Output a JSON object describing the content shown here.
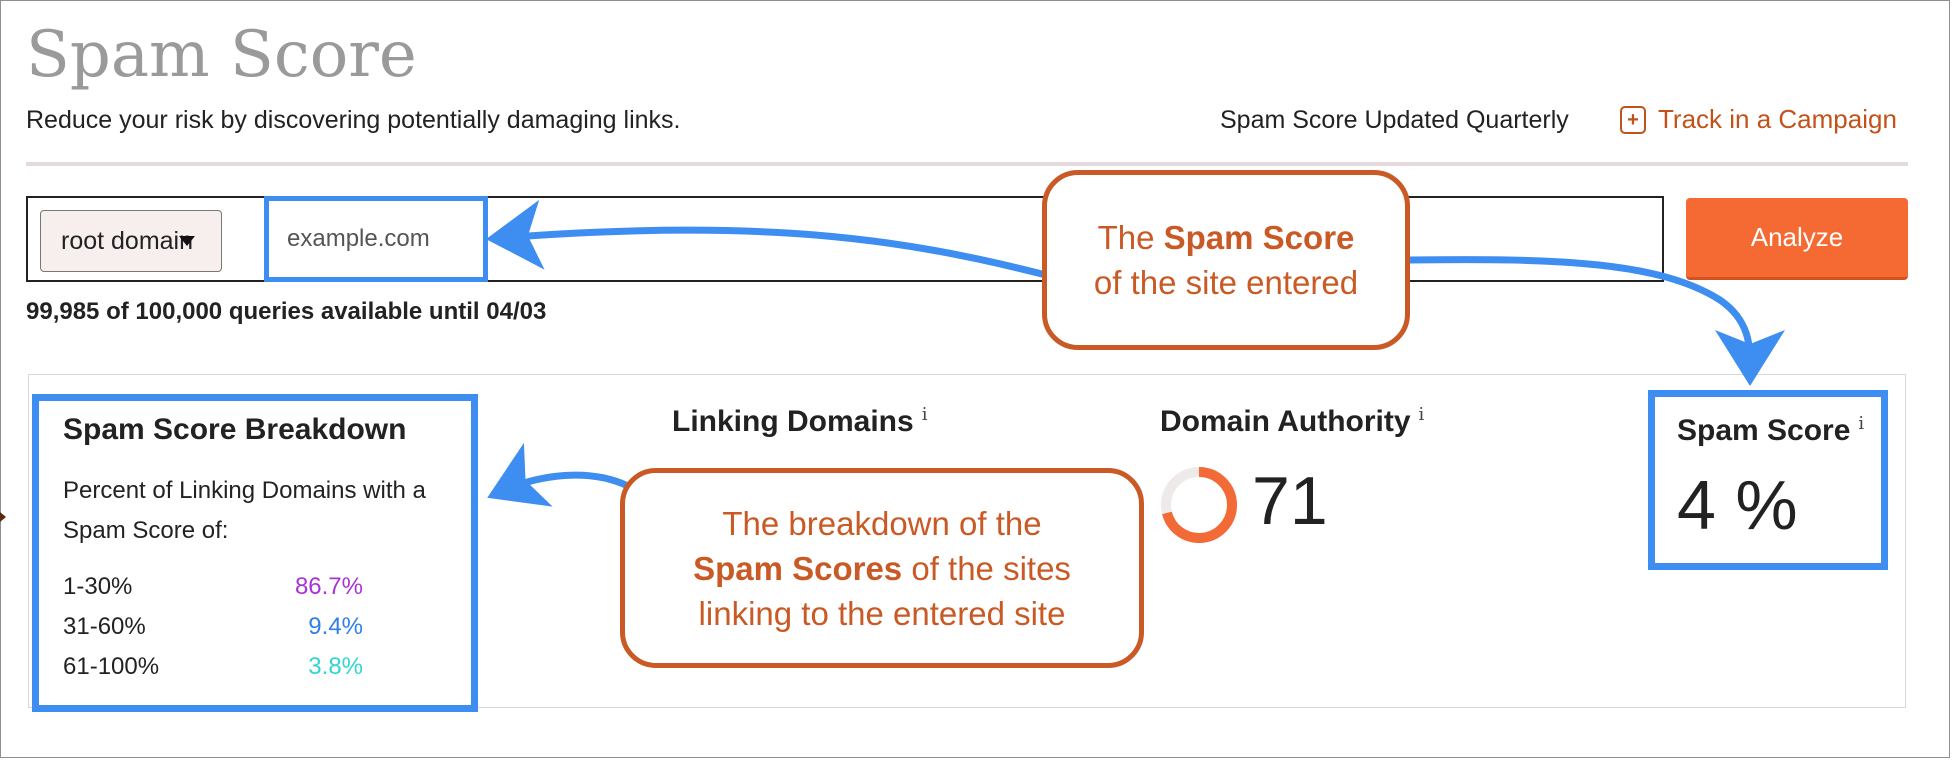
{
  "header": {
    "title": "Spam Score",
    "subtitle": "Reduce your risk by discovering potentially damaging links.",
    "update_note": "Spam Score Updated Quarterly",
    "track_link_label": "Track in a Campaign",
    "track_icon": "plus-box-icon",
    "track_icon_glyph": "+"
  },
  "search": {
    "scope_select": {
      "selected": "root domain",
      "icon": "caret-down-icon"
    },
    "domain_input": {
      "value": "",
      "placeholder": "example.com"
    },
    "analyze_label": "Analyze",
    "queries_status": "99,985 of 100,000 queries available until 04/03"
  },
  "results": {
    "breakdown": {
      "title": "Spam Score Breakdown",
      "description": "Percent of Linking Domains with a Spam Score of:",
      "rows": [
        {
          "range": "1-30%",
          "percent": "86.7%",
          "color": "#a933d6"
        },
        {
          "range": "31-60%",
          "percent": "9.4%",
          "color": "#2f7fe6"
        },
        {
          "range": "61-100%",
          "percent": "3.8%",
          "color": "#2ed6d0"
        }
      ]
    },
    "linking_domains": {
      "title": "Linking Domains",
      "info_glyph": "i"
    },
    "domain_authority": {
      "title": "Domain Authority",
      "info_glyph": "i",
      "value": "71",
      "ring_fraction": 0.71,
      "ring_color": "#f26b36",
      "ring_track_color": "#eeeaea"
    },
    "spam_score": {
      "title": "Spam Score",
      "info_glyph": "i",
      "value": "4 %"
    }
  },
  "annotations": {
    "callout_site": {
      "line1_pre": "The ",
      "line1_bold": "Spam Score",
      "line2": "of the site entered"
    },
    "callout_breakdown": {
      "line1": "The breakdown of the",
      "line2_bold": "Spam Scores",
      "line2_post": " of the sites",
      "line3": "linking to the entered site"
    },
    "arrow_color": "#3d8ef0",
    "callout_color": "#c95a25"
  },
  "colors": {
    "accent_orange": "#f56a32",
    "link_orange": "#c2521a",
    "highlight_blue": "#3d8ef0"
  }
}
